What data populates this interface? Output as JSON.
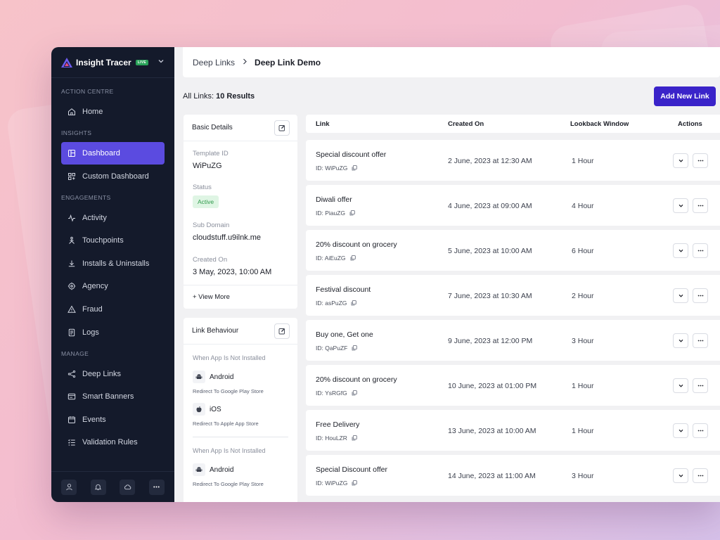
{
  "brand": {
    "name": "Insight Tracer",
    "badge": "LIVE"
  },
  "sidebar": {
    "sections": [
      {
        "title": "ACTION CENTRE",
        "items": [
          {
            "label": "Home",
            "icon": "home-icon"
          }
        ]
      },
      {
        "title": "INSIGHTS",
        "items": [
          {
            "label": "Dashboard",
            "icon": "dashboard-icon",
            "active": true
          },
          {
            "label": "Custom Dashboard",
            "icon": "grid-icon"
          }
        ]
      },
      {
        "title": "ENGAGEMENTS",
        "items": [
          {
            "label": "Activity",
            "icon": "activity-icon"
          },
          {
            "label": "Touchpoints",
            "icon": "touchpoints-icon"
          },
          {
            "label": "Installs & Uninstalls",
            "icon": "download-icon"
          },
          {
            "label": "Agency",
            "icon": "target-icon"
          },
          {
            "label": "Fraud",
            "icon": "warning-icon"
          },
          {
            "label": "Logs",
            "icon": "document-icon"
          }
        ]
      },
      {
        "title": "MANAGE",
        "items": [
          {
            "label": "Deep Links",
            "icon": "share-icon"
          },
          {
            "label": "Smart Banners",
            "icon": "banner-icon"
          },
          {
            "label": "Events",
            "icon": "calendar-icon"
          },
          {
            "label": "Validation Rules",
            "icon": "checklist-icon"
          }
        ]
      }
    ],
    "footer_icons": [
      "user-icon",
      "bell-icon",
      "cloud-icon",
      "more-icon"
    ]
  },
  "breadcrumb": {
    "parent": "Deep Links",
    "current": "Deep Link Demo"
  },
  "results": {
    "label": "All Links:",
    "count": "10 Results"
  },
  "add_button": "Add New Link",
  "basic_details": {
    "title": "Basic Details",
    "template_id_label": "Template ID",
    "template_id": "WiPuZG",
    "status_label": "Status",
    "status": "Active",
    "sub_domain_label": "Sub Domain",
    "sub_domain": "cloudstuff.u9ilnk.me",
    "created_on_label": "Created On",
    "created_on": "3 May, 2023, 10:00 AM",
    "view_more": "+ View More"
  },
  "link_behaviour": {
    "title": "Link Behaviour",
    "group1_label": "When App Is Not Installed",
    "android": "Android",
    "android_note": "Redirect To Google Play Store",
    "ios": "iOS",
    "ios_note": "Redirect To Apple App Store",
    "group2_label": "When App Is Not Installed"
  },
  "table": {
    "columns": [
      "Link",
      "Created On",
      "Lookback Window",
      "Actions"
    ],
    "rows": [
      {
        "name": "Special discount offer",
        "id": "ID: WiPuZG",
        "created": "2 June, 2023 at 12:30 AM",
        "lookback": "1 Hour"
      },
      {
        "name": "Diwali offer",
        "id": "ID: PiauZG",
        "created": "4 June, 2023 at 09:00 AM",
        "lookback": "4 Hour"
      },
      {
        "name": "20% discount on grocery",
        "id": "ID: AiEuZG",
        "created": "5 June, 2023 at 10:00 AM",
        "lookback": "6 Hour"
      },
      {
        "name": "Festival discount",
        "id": "ID: asPuZG",
        "created": "7 June, 2023 at 10:30 AM",
        "lookback": "2 Hour"
      },
      {
        "name": "Buy one, Get one",
        "id": "ID: QaPuZF",
        "created": "9 June, 2023 at 12:00 PM",
        "lookback": "3 Hour"
      },
      {
        "name": "20% discount on grocery",
        "id": "ID: YsRGfG",
        "created": "10 June, 2023 at 01:00 PM",
        "lookback": "1 Hour"
      },
      {
        "name": "Free Delivery",
        "id": "ID: HouLZR",
        "created": "13 June, 2023 at 10:00 AM",
        "lookback": "1 Hour"
      },
      {
        "name": "Special Discount offer",
        "id": "ID: WiPuZG",
        "created": "14 June, 2023 at 11:00 AM",
        "lookback": "3 Hour"
      }
    ]
  }
}
